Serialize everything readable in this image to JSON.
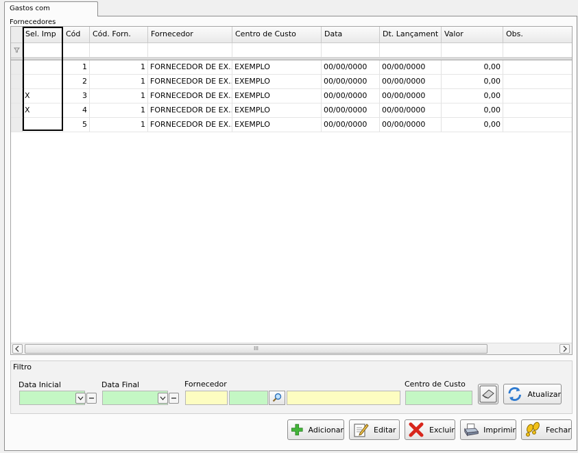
{
  "tab": {
    "label": "Gastos com Fornecedores"
  },
  "grid": {
    "columns": [
      {
        "key": "sel",
        "label": "Sel. Imp"
      },
      {
        "key": "cod",
        "label": "Cód"
      },
      {
        "key": "cod_forn",
        "label": "Cód. Forn."
      },
      {
        "key": "fornecedor",
        "label": "Fornecedor"
      },
      {
        "key": "centro_custo",
        "label": "Centro de Custo"
      },
      {
        "key": "data",
        "label": "Data"
      },
      {
        "key": "dt_lanc",
        "label": "Dt. Lançament"
      },
      {
        "key": "valor",
        "label": "Valor"
      },
      {
        "key": "obs",
        "label": "Obs."
      }
    ],
    "rows": [
      [
        "",
        "1",
        "1",
        "FORNECEDOR DE EX...",
        "EXEMPLO",
        "00/00/0000",
        "00/00/0000",
        "0,00",
        ""
      ],
      [
        "",
        "2",
        "1",
        "FORNECEDOR DE EX...",
        "EXEMPLO",
        "00/00/0000",
        "00/00/0000",
        "0,00",
        ""
      ],
      [
        "X",
        "3",
        "1",
        "FORNECEDOR DE EX...",
        "EXEMPLO",
        "00/00/0000",
        "00/00/0000",
        "0,00",
        ""
      ],
      [
        "X",
        "4",
        "1",
        "FORNECEDOR DE EX...",
        "EXEMPLO",
        "00/00/0000",
        "00/00/0000",
        "0,00",
        ""
      ],
      [
        "",
        "5",
        "1",
        "FORNECEDOR DE EX...",
        "EXEMPLO",
        "00/00/0000",
        "00/00/0000",
        "0,00",
        ""
      ]
    ],
    "filter_icon": "filter-icon",
    "scroll_thumb_grip": "III"
  },
  "filter": {
    "title": "Filtro",
    "data_inicial": {
      "label": "Data Inicial",
      "value": ""
    },
    "data_final": {
      "label": "Data Final",
      "value": ""
    },
    "fornecedor": {
      "label": "Fornecedor",
      "code": "",
      "name": ""
    },
    "centro_custo": {
      "label": "Centro de Custo",
      "value": ""
    },
    "atualizar_label": "Atualizar",
    "input_colors": {
      "green": "#c4f7c4",
      "yellow": "#fdfdc1"
    }
  },
  "actions": {
    "adicionar": "Adicionar",
    "editar": "Editar",
    "excluir": "Excluir",
    "imprimir": "Imprimir",
    "fechar": "Fechar"
  }
}
